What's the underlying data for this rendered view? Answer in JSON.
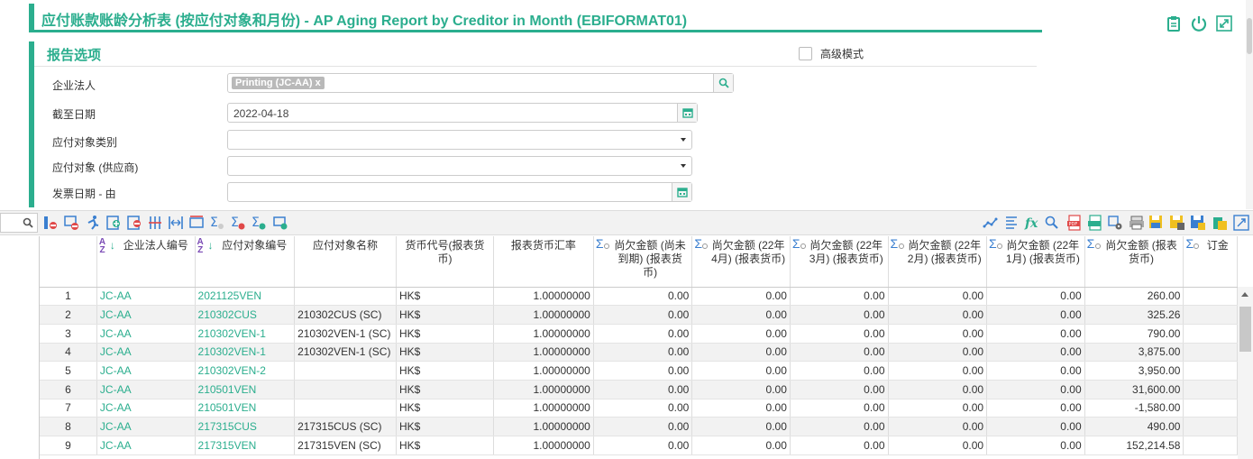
{
  "title": "应付账款账龄分析表 (按应付对象和月份) - AP Aging Report by Creditor in Month (EBIFORMAT01)",
  "top_icons": [
    "clipboard-icon",
    "power-icon",
    "expand-icon"
  ],
  "options": {
    "title": "报告选项",
    "advanced_label": "高级模式",
    "fields": [
      {
        "label": "企业法人",
        "tag": "Printing (JC-AA) x"
      },
      {
        "label": "截至日期",
        "value": "2022-04-18"
      },
      {
        "label": "应付对象类别",
        "value": ""
      },
      {
        "label": "应付对象 (供应商)",
        "value": ""
      },
      {
        "label": "发票日期 - 由",
        "value": ""
      }
    ]
  },
  "table": {
    "columns": [
      "",
      "企业法人编号",
      "应付对象编号",
      "应付对象名称",
      "货币代号(报表货币)",
      "报表货币汇率",
      "尚欠金额 (尚未到期) (报表货币)",
      "尚欠金额 (22年4月) (报表货币)",
      "尚欠金额 (22年3月) (报表货币)",
      "尚欠金额 (22年2月) (报表货币)",
      "尚欠金额 (22年1月) (报表货币)",
      "尚欠金额 (报表货币)",
      "订金"
    ],
    "rows": [
      [
        "1",
        "JC-AA",
        "2021125VEN",
        "",
        "HK$",
        "1.00000000",
        "0.00",
        "0.00",
        "0.00",
        "0.00",
        "0.00",
        "260.00"
      ],
      [
        "2",
        "JC-AA",
        "210302CUS",
        "210302CUS (SC)",
        "HK$",
        "1.00000000",
        "0.00",
        "0.00",
        "0.00",
        "0.00",
        "0.00",
        "325.26"
      ],
      [
        "3",
        "JC-AA",
        "210302VEN-1",
        "210302VEN-1 (SC)",
        "HK$",
        "1.00000000",
        "0.00",
        "0.00",
        "0.00",
        "0.00",
        "0.00",
        "790.00"
      ],
      [
        "4",
        "JC-AA",
        "210302VEN-1",
        "210302VEN-1 (SC)",
        "HK$",
        "1.00000000",
        "0.00",
        "0.00",
        "0.00",
        "0.00",
        "0.00",
        "3,875.00"
      ],
      [
        "5",
        "JC-AA",
        "210302VEN-2",
        "",
        "HK$",
        "1.00000000",
        "0.00",
        "0.00",
        "0.00",
        "0.00",
        "0.00",
        "3,950.00"
      ],
      [
        "6",
        "JC-AA",
        "210501VEN",
        "",
        "HK$",
        "1.00000000",
        "0.00",
        "0.00",
        "0.00",
        "0.00",
        "0.00",
        "31,600.00"
      ],
      [
        "7",
        "JC-AA",
        "210501VEN",
        "",
        "HK$",
        "1.00000000",
        "0.00",
        "0.00",
        "0.00",
        "0.00",
        "0.00",
        "-1,580.00"
      ],
      [
        "8",
        "JC-AA",
        "217315CUS",
        "217315CUS (SC)",
        "HK$",
        "1.00000000",
        "0.00",
        "0.00",
        "0.00",
        "0.00",
        "0.00",
        "490.00"
      ],
      [
        "9",
        "JC-AA",
        "217315VEN",
        "217315VEN (SC)",
        "HK$",
        "1.00000000",
        "0.00",
        "0.00",
        "0.00",
        "0.00",
        "0.00",
        "152,214.58"
      ]
    ]
  }
}
